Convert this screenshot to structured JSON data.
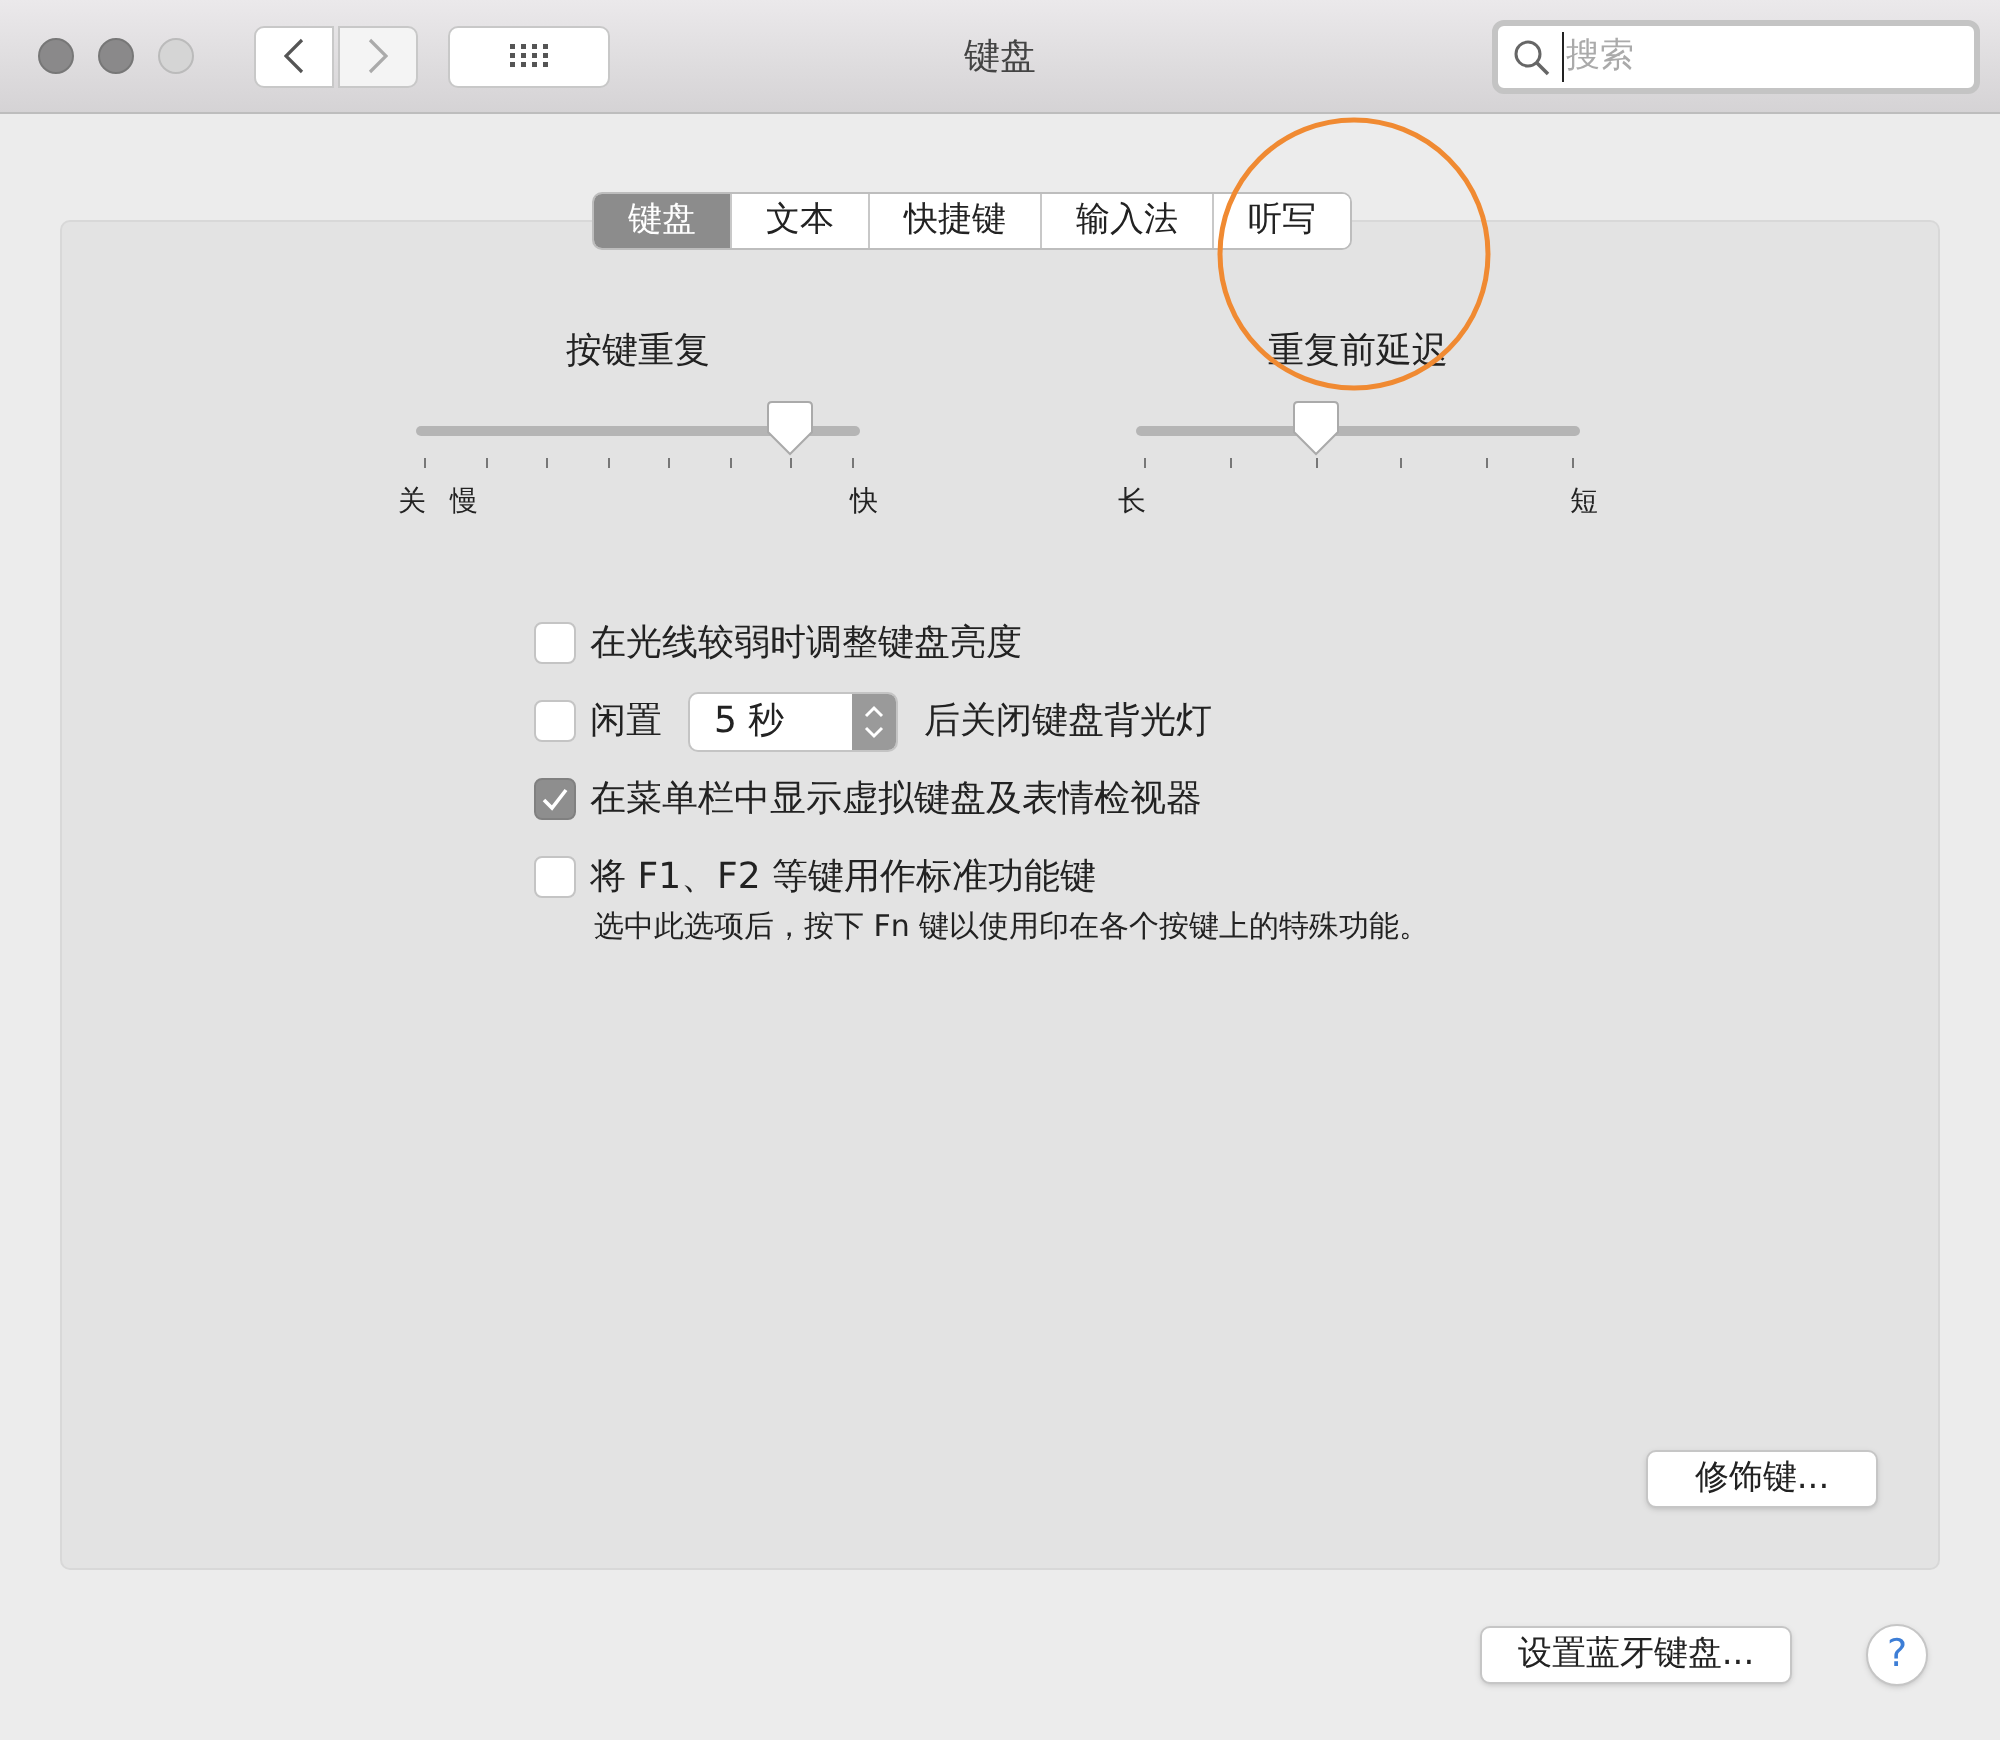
{
  "window": {
    "title": "键盘",
    "search": {
      "placeholder": "搜索"
    }
  },
  "tabs": [
    {
      "label": "键盘",
      "selected": true
    },
    {
      "label": "文本",
      "selected": false
    },
    {
      "label": "快捷键",
      "selected": false
    },
    {
      "label": "输入法",
      "selected": false
    },
    {
      "label": "听写",
      "selected": false
    }
  ],
  "sliders": [
    {
      "title": "按键重复",
      "level": 0.857,
      "labels": [
        "关",
        "慢",
        "快"
      ]
    },
    {
      "title": "重复前延迟",
      "level": 0.4,
      "labels": [
        "长",
        "短"
      ]
    }
  ],
  "options": [
    {
      "kind": "checkbox",
      "label": "在光线较弱时调整键盘亮度",
      "checked": false
    },
    {
      "kind": "stepper",
      "label": "闲置",
      "value": "5 秒",
      "after": "后关闭键盘背光灯",
      "checked": false
    },
    {
      "kind": "checkbox",
      "label": "在菜单栏中显示虚拟键盘及表情检视器",
      "checked": true
    },
    {
      "kind": "checkbox",
      "label": "将 F1、F2 等键用作标准功能键",
      "checked": false,
      "note": "选中此选项后，按下 Fn 键以使用印在各个按键上的特殊功能。"
    }
  ],
  "modifier_button": "修饰键...",
  "bluetooth_button": "设置蓝牙键盘...",
  "help_button": "?"
}
